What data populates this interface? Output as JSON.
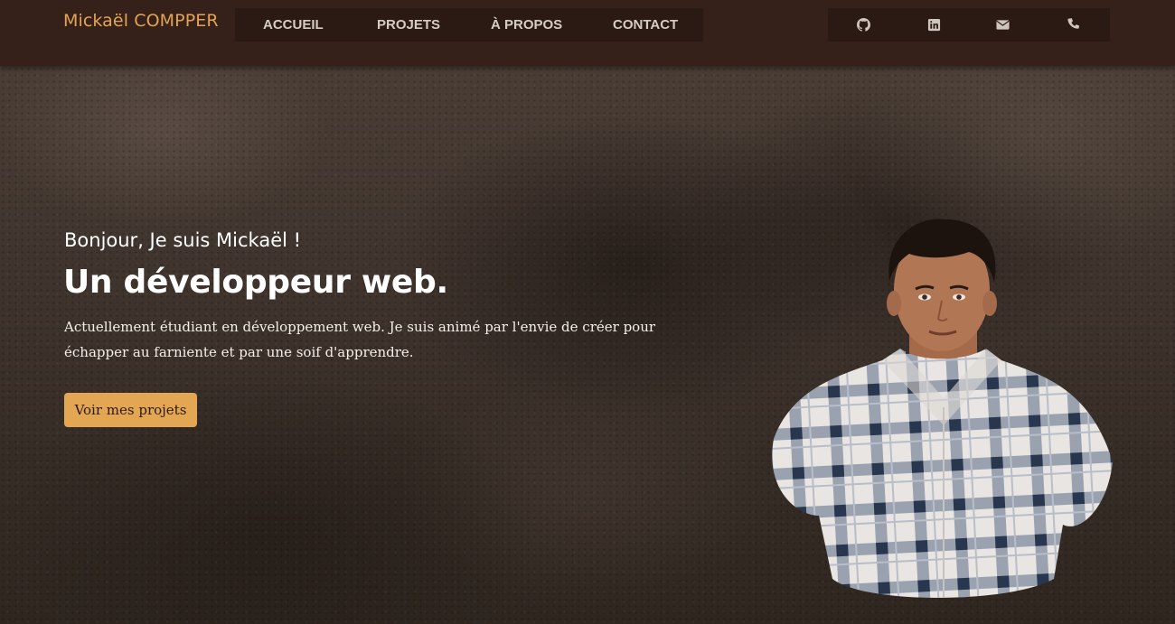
{
  "header": {
    "brand": "Mickaël COMPPER",
    "nav": [
      {
        "label": "ACCUEIL"
      },
      {
        "label": "PROJETS"
      },
      {
        "label": "À PROPOS"
      },
      {
        "label": "CONTACT"
      }
    ],
    "social": [
      {
        "icon": "github-icon"
      },
      {
        "icon": "linkedin-icon"
      },
      {
        "icon": "envelope-icon"
      },
      {
        "icon": "phone-icon"
      }
    ]
  },
  "hero": {
    "greeting": "Bonjour, Je suis Mickaël !",
    "headline": "Un développeur web.",
    "intro": "Actuellement étudiant en développement web. Je suis animé par l'envie de créer pour échapper au farniente et par une soif d'apprendre.",
    "cta_label": "Voir mes projets"
  },
  "colors": {
    "accent": "#e2a453",
    "header_bg": "#35211a",
    "nav_bg": "#2b1a14",
    "text_light": "#ffffff"
  }
}
